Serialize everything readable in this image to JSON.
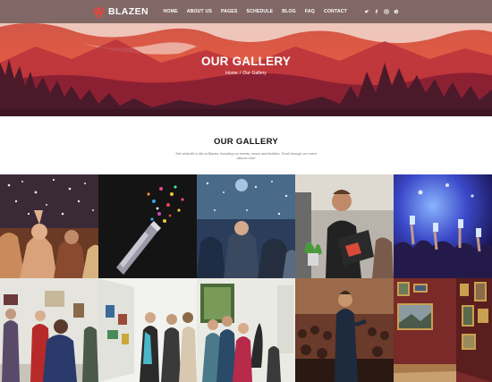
{
  "brand": {
    "name": "BLAZEN"
  },
  "nav": {
    "items": [
      "HOME",
      "ABOUT US",
      "PAGES",
      "SCHEDULE",
      "BLOG",
      "FAQ",
      "CONTACT"
    ],
    "social": [
      "twitter-icon",
      "facebook-icon",
      "instagram-icon",
      "dribbble-icon"
    ]
  },
  "hero": {
    "title": "OUR GALLERY",
    "breadcrumb": {
      "home": "Home",
      "separator": "/",
      "current": "Our Gallery"
    }
  },
  "section": {
    "title": "OUR GALLERY",
    "description": "See what life is like at Blazen, including our events, rooms and facilities. Scroll through our event albums now!"
  },
  "gallery": {
    "photos": [
      {
        "subject": "confetti party crowd"
      },
      {
        "subject": "confetti popper"
      },
      {
        "subject": "blue confetti party"
      },
      {
        "subject": "speaker with laptop"
      },
      {
        "subject": "concert crowd phones"
      },
      {
        "subject": "visitors at art gallery"
      },
      {
        "subject": "exhibition visitors"
      },
      {
        "subject": "women viewing artwork"
      },
      {
        "subject": "presenter on stage"
      },
      {
        "subject": "paintings on wall"
      }
    ]
  },
  "colors": {
    "hero_red": "#d9453a",
    "accent": "#e8463c",
    "heading": "#111111"
  }
}
